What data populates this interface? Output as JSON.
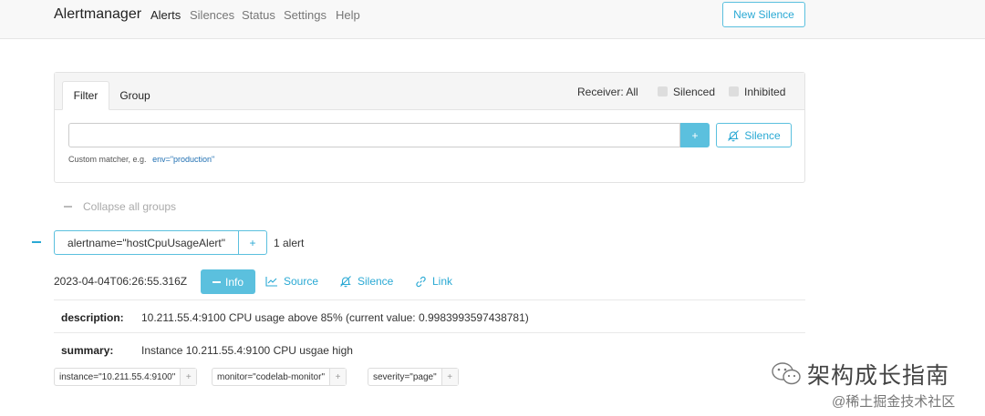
{
  "navbar": {
    "brand": "Alertmanager",
    "items": [
      {
        "label": "Alerts",
        "active": true
      },
      {
        "label": "Silences",
        "active": false
      },
      {
        "label": "Status",
        "active": false
      },
      {
        "label": "Settings",
        "active": false
      },
      {
        "label": "Help",
        "active": false
      }
    ],
    "new_silence_label": "New Silence"
  },
  "filter": {
    "tabs": [
      "Filter",
      "Group"
    ],
    "receiver_label": "Receiver: All",
    "silenced_label": "Silenced",
    "inhibited_label": "Inhibited",
    "input_value": "",
    "add_label": "+",
    "silence_label": "Silence",
    "hint_text": "Custom matcher, e.g.",
    "hint_example": "env=\"production\""
  },
  "collapse_all_label": "Collapse all groups",
  "group": {
    "label": "alertname=\"hostCpuUsageAlert\"",
    "add_label": "+",
    "count_text": "1 alert"
  },
  "alert": {
    "timestamp": "2023-04-04T06:26:55.316Z",
    "info_label": "Info",
    "source_label": "Source",
    "silence_label": "Silence",
    "link_label": "Link",
    "annotations": [
      {
        "key": "description:",
        "value": "10.211.55.4:9100 CPU usage above 85% (current value: 0.9983993597438781)"
      },
      {
        "key": "summary:",
        "value": "Instance 10.211.55.4:9100 CPU usgae high"
      }
    ],
    "labels": [
      {
        "text": "instance=\"10.211.55.4:9100\"",
        "add": "+"
      },
      {
        "text": "monitor=\"codelab-monitor\"",
        "add": "+"
      },
      {
        "text": "severity=\"page\"",
        "add": "+"
      }
    ]
  },
  "watermark": {
    "line1": "架构成长指南",
    "line2": "@稀土掘金技术社区"
  },
  "colors": {
    "accent": "#5bc0de",
    "link": "#2aa9d4"
  }
}
